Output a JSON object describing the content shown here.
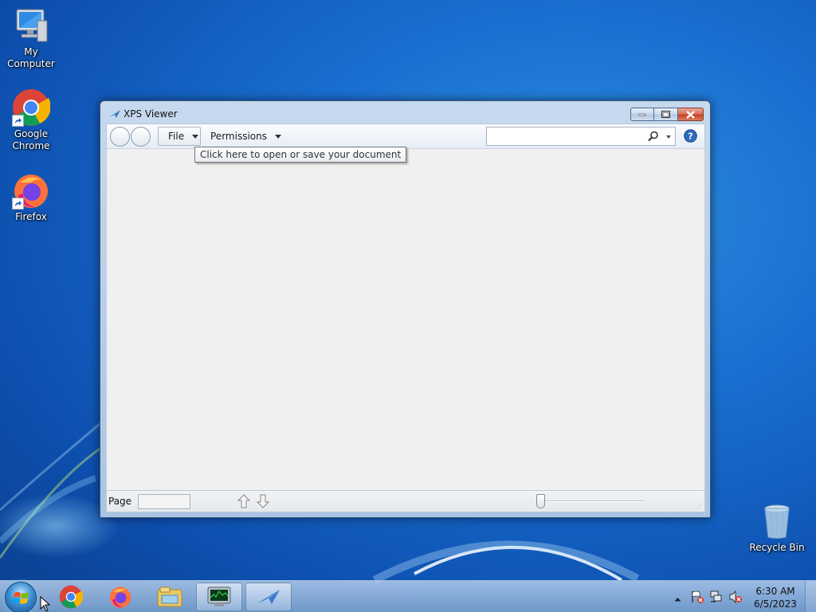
{
  "desktop": {
    "icons": [
      {
        "label": "My Computer",
        "icon": "computer-icon"
      },
      {
        "label": "Google Chrome",
        "icon": "chrome-icon"
      },
      {
        "label": "Firefox",
        "icon": "firefox-icon"
      },
      {
        "label": "Recycle Bin",
        "icon": "recycle-bin-icon"
      }
    ]
  },
  "window": {
    "title": "XPS Viewer",
    "toolbar": {
      "file_label": "File",
      "permissions_label": "Permissions",
      "search_value": "",
      "search_placeholder": ""
    },
    "tooltip": "Click here to open or save your document",
    "statusbar": {
      "page_label": "Page",
      "page_value": ""
    }
  },
  "taskbar": {
    "items": [
      "chrome-icon",
      "firefox-icon",
      "file-explorer-icon",
      "task-manager-icon",
      "xps-viewer-icon"
    ],
    "active_item": "xps-viewer-icon",
    "clock": {
      "time": "6:30 AM",
      "date": "6/5/2023"
    }
  },
  "colors": {
    "desktop_blue": "#1a6fd0",
    "window_frame": "#a9c4e4",
    "close_red": "#c6401f"
  }
}
